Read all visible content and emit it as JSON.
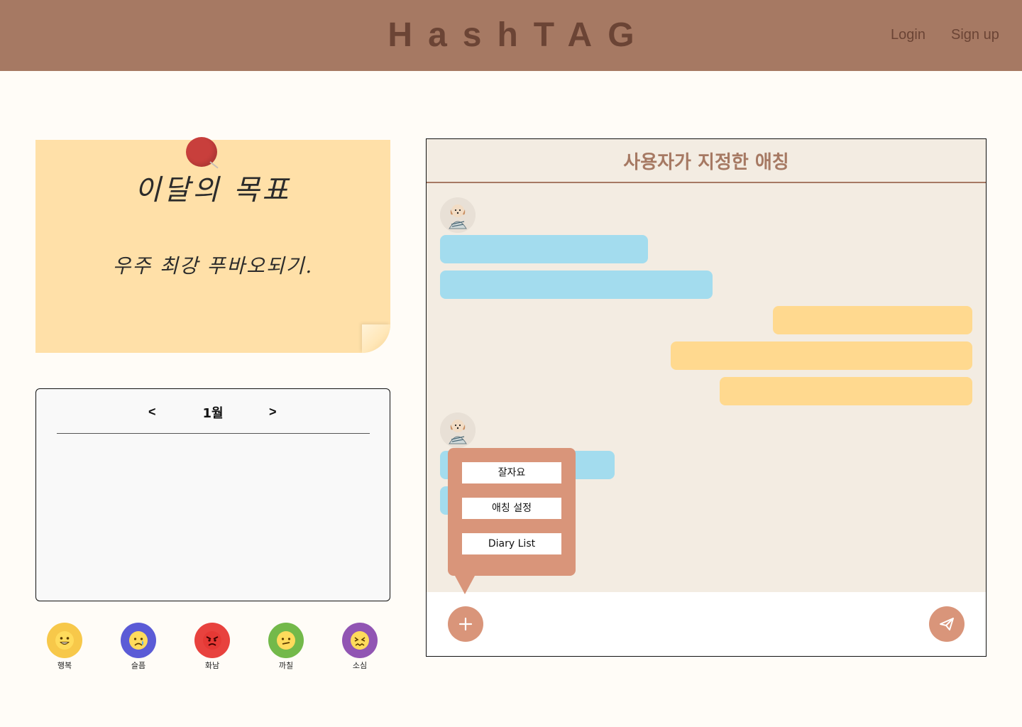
{
  "header": {
    "brand": "HashTAG",
    "login": "Login",
    "signup": "Sign up"
  },
  "note": {
    "title": "이달의 목표",
    "goal": "우주 최강 푸바오되기."
  },
  "calendar": {
    "prev": "<",
    "month": "1월",
    "next": ">"
  },
  "emotions": [
    {
      "label": "행복",
      "color": "#f7c84a",
      "icon": "happy-face-icon"
    },
    {
      "label": "슬픔",
      "color": "#5b5bd6",
      "icon": "crying-face-icon"
    },
    {
      "label": "화남",
      "color": "#e8423e",
      "icon": "angry-face-icon"
    },
    {
      "label": "까칠",
      "color": "#73b94a",
      "icon": "confused-face-icon"
    },
    {
      "label": "소심",
      "color": "#9155b3",
      "icon": "anxious-face-icon"
    }
  ],
  "chat": {
    "title": "사용자가 지정한 애칭",
    "colors": {
      "header": "#a67963",
      "left_bubble": "#a3dcee",
      "right_bubble": "#ffd98f",
      "button": "#d9957a"
    }
  },
  "popup_menu": {
    "items": [
      "잘자요",
      "애칭 설정",
      "Diary List"
    ]
  }
}
